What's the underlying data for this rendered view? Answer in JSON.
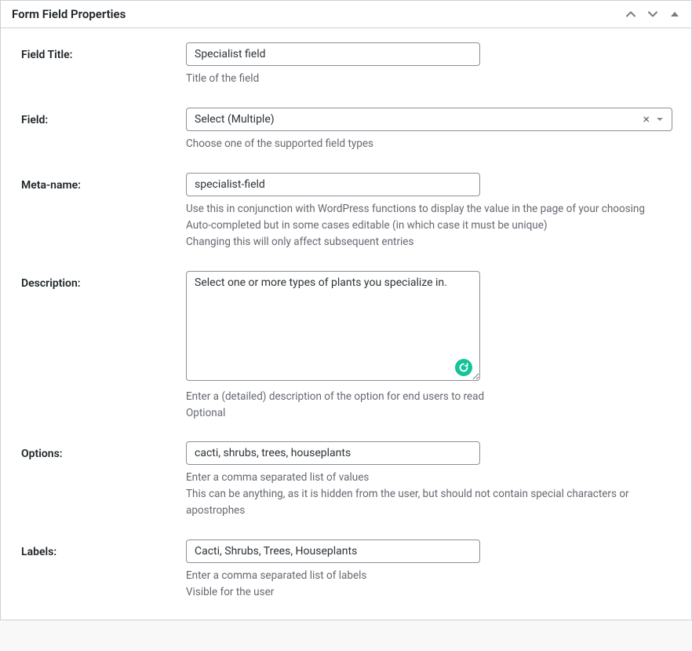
{
  "panel": {
    "title": "Form Field Properties"
  },
  "fields": {
    "fieldTitle": {
      "label": "Field Title:",
      "value": "Specialist field",
      "help": "Title of the field"
    },
    "field": {
      "label": "Field:",
      "value": "Select (Multiple)",
      "help": "Choose one of the supported field types"
    },
    "metaName": {
      "label": "Meta-name:",
      "value": "specialist-field",
      "help": "Use this in conjunction with WordPress functions to display the value in the page of your choosing\nAuto-completed but in some cases editable (in which case it must be unique)\nChanging this will only affect subsequent entries"
    },
    "description": {
      "label": "Description:",
      "value": "Select one or more types of plants you specialize in.",
      "help": "Enter a (detailed) description of the option for end users to read\nOptional"
    },
    "options": {
      "label": "Options:",
      "value": "cacti, shrubs, trees, houseplants",
      "help": "Enter a comma separated list of values\nThis can be anything, as it is hidden from the user, but should not contain special characters or apostrophes"
    },
    "labels": {
      "label": "Labels:",
      "value": "Cacti, Shrubs, Trees, Houseplants",
      "help": "Enter a comma separated list of labels\nVisible for the user"
    }
  }
}
